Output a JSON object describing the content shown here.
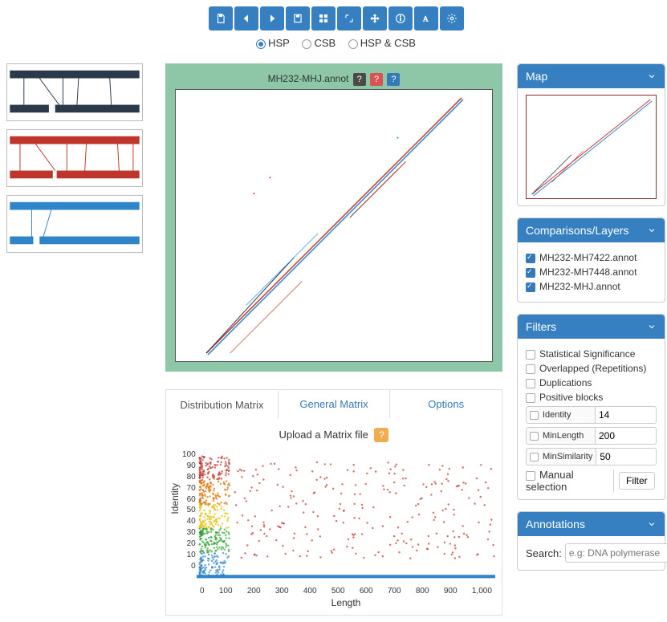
{
  "toolbar": {
    "icons": [
      "save",
      "prev",
      "next",
      "floppy",
      "grid",
      "fit",
      "move",
      "info",
      "font",
      "gear"
    ]
  },
  "view_mode": {
    "options": [
      "HSP",
      "CSB",
      "HSP & CSB"
    ],
    "selected": "HSP"
  },
  "dotplot": {
    "title": "MH232-MHJ.annot",
    "badges": [
      "?",
      "?",
      "?"
    ]
  },
  "tabs": {
    "items": [
      "Distribution Matrix",
      "General Matrix",
      "Options"
    ],
    "active": 0,
    "upload_label": "Upload a Matrix file"
  },
  "chart_data": {
    "type": "scatter",
    "xlabel": "Length",
    "ylabel": "Identity",
    "xlim": [
      0,
      1000
    ],
    "ylim": [
      0,
      100
    ],
    "xticks": [
      0,
      100,
      200,
      300,
      400,
      500,
      600,
      700,
      800,
      900,
      "1,000"
    ],
    "yticks": [
      100,
      90,
      80,
      70,
      60,
      50,
      40,
      30,
      20,
      10,
      0
    ],
    "note": "dense cloud near Length 50–150 spanning Identity 5–100; sparser red points spread across Length 150–1000 mostly Identity 20–95"
  },
  "panels": {
    "map": {
      "title": "Map"
    },
    "comparisons": {
      "title": "Comparisons/Layers",
      "items": [
        "MH232-MH7422.annot",
        "MH232-MH7448.annot",
        "MH232-MHJ.annot"
      ]
    },
    "filters": {
      "title": "Filters",
      "flags": [
        "Statistical Significance",
        "Overlapped (Repetitions)",
        "Duplications",
        "Positive blocks"
      ],
      "identity_label": "Identity",
      "identity_value": 14,
      "minlength_label": "MinLength",
      "minlength_value": 200,
      "minsim_label": "MinSimilarity",
      "minsim_value": 50,
      "manual_label": "Manual selection",
      "filter_btn": "Filter"
    },
    "annotations": {
      "title": "Annotations",
      "search_label": "Search:",
      "placeholder": "e.g: DNA polymerase"
    }
  }
}
